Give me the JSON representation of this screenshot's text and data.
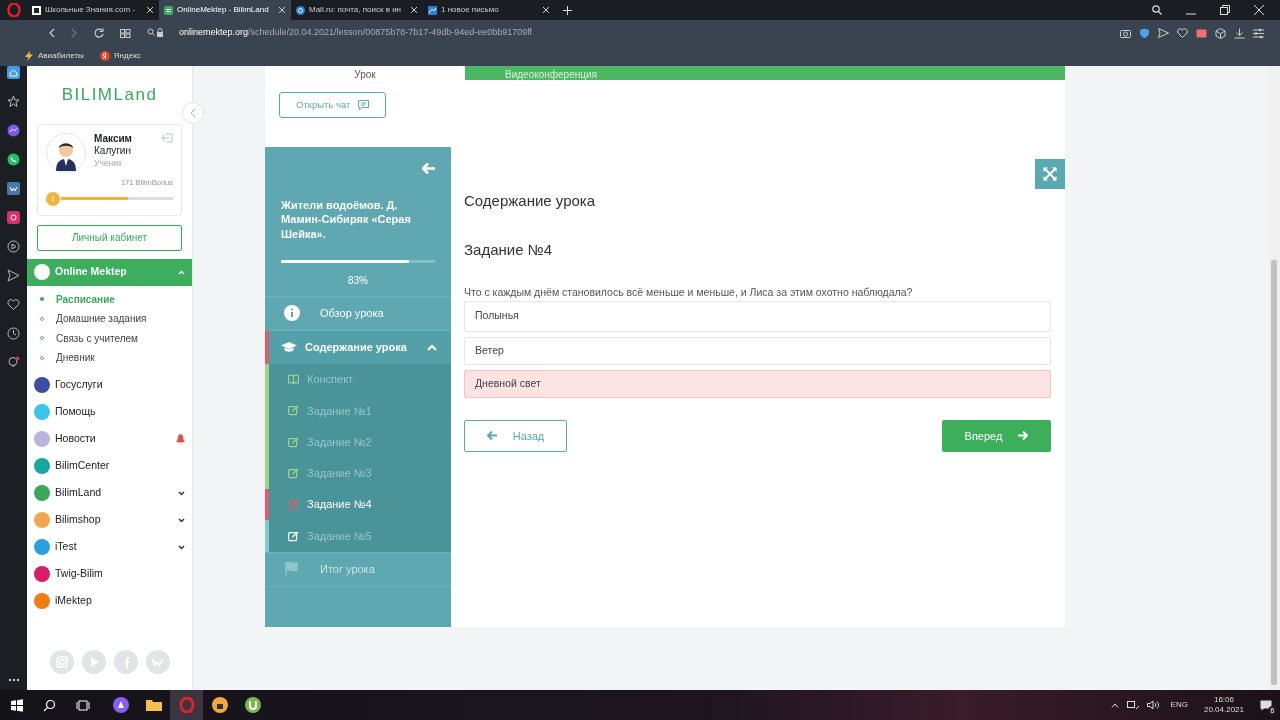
{
  "browser": {
    "tabs": [
      {
        "label": "Школьные Знания.com -",
        "selected": false
      },
      {
        "label": "OnlineMektep - BilimLand",
        "selected": true
      },
      {
        "label": "Mail.ru: почта, поиск в ин",
        "selected": false
      },
      {
        "label": "1 новое письмо",
        "selected": false
      }
    ],
    "url_host": "onlinemektep.org",
    "url_path": "/schedule/20.04.2021/lesson/00875b78-7b17-49db-94ed-ee0bb91709ff",
    "bookmarks": [
      {
        "label": "Авиабилеты",
        "kind": "flight"
      },
      {
        "label": "Яндекс",
        "kind": "yandex"
      }
    ]
  },
  "sidebar": {
    "logo": "BILIMLand",
    "user": {
      "first_name": "Максим",
      "last_name": "Калугин",
      "role": "Ученик",
      "bonus": "171 BilimBonus",
      "level_badge": "1",
      "level": 0.6
    },
    "cabinet_button": "Личный кабинет",
    "menu": [
      {
        "label": "Online Mektep",
        "selected": true,
        "expanded": true,
        "color": "#ffffff",
        "children": [
          {
            "label": "Расписание",
            "selected": true
          },
          {
            "label": "Домашние задания",
            "selected": false
          },
          {
            "label": "Связь с учителем",
            "selected": false
          },
          {
            "label": "Дневник",
            "selected": false
          }
        ]
      },
      {
        "label": "Госуслуги",
        "selected": false,
        "color": "#3b4fa0"
      },
      {
        "label": "Помощь",
        "selected": false,
        "color": "#3bc6e8"
      },
      {
        "label": "Новости",
        "selected": false,
        "color": "#b9b4e0",
        "notification": true
      },
      {
        "label": "BilimCenter",
        "selected": false,
        "color": "#1aa6a0"
      },
      {
        "label": "BilimLand",
        "selected": false,
        "color": "#3aa85a",
        "expanded": false
      },
      {
        "label": "Bilimshop",
        "selected": false,
        "color": "#f0a850",
        "expanded": false
      },
      {
        "label": "iTest",
        "selected": false,
        "color": "#2b9ee0",
        "expanded": false
      },
      {
        "label": "Twig-Bilim",
        "selected": false,
        "color": "#d81b6b"
      },
      {
        "label": "iMektep",
        "selected": false,
        "color": "#ef7d14"
      }
    ]
  },
  "lesson": {
    "top_label": "Урок",
    "video_bar": "Видеоконференция",
    "chat_button": "Открыть чат",
    "title": "Жители водоёмов. Д. Мамин-Сибиряк «Серая Шейка».",
    "level": 0.83,
    "progress_text": "83%",
    "nav": [
      {
        "label": "Обзор урока",
        "kind": "info",
        "disabled": false
      },
      {
        "label": "Содержание урока",
        "kind": "section",
        "disabled": false,
        "expanded": true,
        "children": [
          {
            "label": "Конспект",
            "kind": "notes",
            "color": "#9ed48a",
            "selected": false
          },
          {
            "label": "Задание №1",
            "kind": "task",
            "color": "#9ed48a",
            "selected": false
          },
          {
            "label": "Задание №2",
            "kind": "task",
            "color": "#9ed48a",
            "selected": false
          },
          {
            "label": "Задание №3",
            "kind": "task",
            "color": "#9ed48a",
            "selected": false
          },
          {
            "label": "Задание №4",
            "kind": "task",
            "color": "#d9606e",
            "selected": true
          },
          {
            "label": "Задание №5",
            "kind": "task",
            "color": "#86c9cc",
            "selected": false
          }
        ]
      },
      {
        "label": "Итог урока",
        "kind": "flag",
        "disabled": true
      }
    ]
  },
  "content": {
    "heading": "Содержание урока",
    "task_title": "Задание №4",
    "question": "Что с каждым днём становилось всё меньше и меньше, и Лиса за этим охотно наблюдала?",
    "options": [
      {
        "text": "Полынья",
        "selected": false
      },
      {
        "text": "Ветер",
        "selected": false
      },
      {
        "text": "Дневной свет",
        "selected": true
      }
    ],
    "back_button": "Назад",
    "next_button": "Вперед"
  },
  "taskbar": {
    "language": "ENG",
    "time": "16:06",
    "date": "20.04.2021",
    "notifications": "6"
  }
}
